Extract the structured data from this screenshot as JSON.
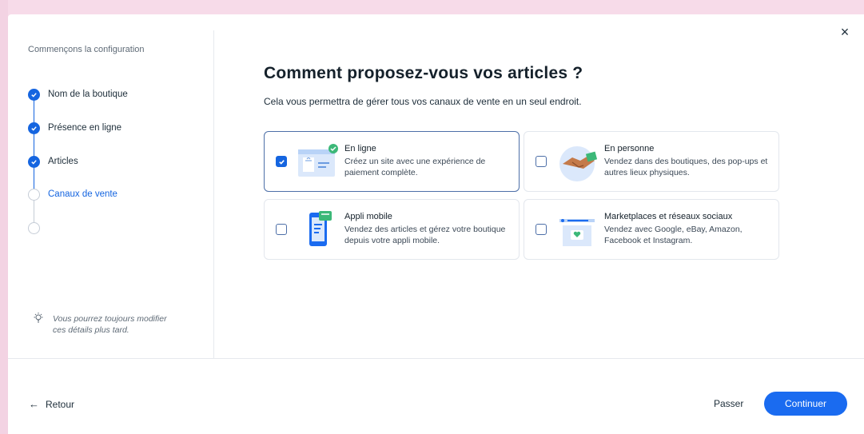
{
  "dialog": {
    "close_symbol": "×"
  },
  "sidebar": {
    "title": "Commençons la configuration",
    "steps": [
      {
        "label": "Nom de la boutique",
        "state": "done"
      },
      {
        "label": "Présence en ligne",
        "state": "done"
      },
      {
        "label": "Articles",
        "state": "done"
      },
      {
        "label": "Canaux de vente",
        "state": "current"
      },
      {
        "label": "",
        "state": "upcoming"
      }
    ],
    "tip": "Vous pourrez toujours modifier ces détails plus tard."
  },
  "main": {
    "title": "Comment proposez-vous vos articles ?",
    "subtitle": "Cela vous permettra de gérer tous vos canaux de vente en un seul endroit.",
    "options": [
      {
        "title": "En ligne",
        "description": "Créez un site avec une expérience de paiement complète.",
        "checked": true,
        "icon": "online-store-icon"
      },
      {
        "title": "En personne",
        "description": "Vendez dans des boutiques, des pop-ups et autres lieux physiques.",
        "checked": false,
        "icon": "handshake-icon"
      },
      {
        "title": "Appli mobile",
        "description": "Vendez des articles et gérez votre boutique depuis votre appli mobile.",
        "checked": false,
        "icon": "mobile-app-icon"
      },
      {
        "title": "Marketplaces et réseaux sociaux",
        "description": "Vendez avec Google, eBay, Amazon, Facebook et Instagram.",
        "checked": false,
        "icon": "marketplace-icon"
      }
    ]
  },
  "footer": {
    "back_label": "Retour",
    "back_arrow": "←",
    "skip_label": "Passer",
    "continue_label": "Continuer"
  },
  "colors": {
    "accent": "#1565e0",
    "button": "#1a6bf0",
    "backdrop": "#fbe9f3"
  }
}
